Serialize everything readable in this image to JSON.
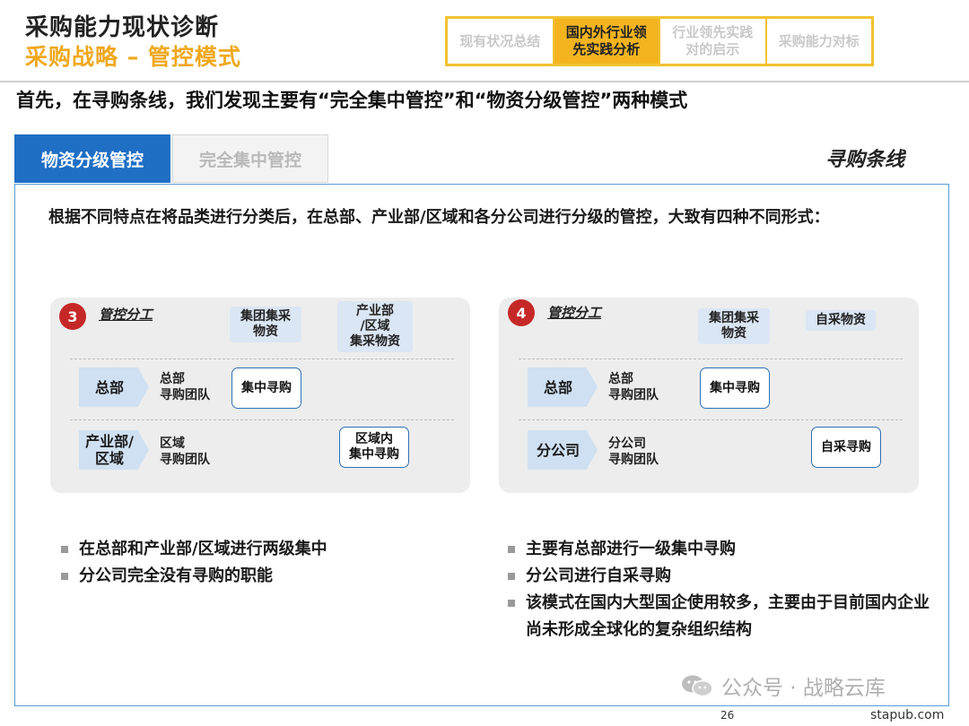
{
  "header": {
    "title": "采购能力现状诊断",
    "subtitle": "采购战略 – 管控模式",
    "nav_tabs": [
      {
        "label": "现有状况总结",
        "active": false
      },
      {
        "label": "国内外行业领\n先实践分析",
        "active": true
      },
      {
        "label": "行业领先实践\n对的启示",
        "active": false
      },
      {
        "label": "采购能力对标",
        "active": false
      }
    ]
  },
  "headline": "首先，在寻购条线，我们发现主要有“完全集中管控”和“物资分级管控”两种模式",
  "tabs": {
    "active": "物资分级管控",
    "inactive": "完全集中管控",
    "right_label": "寻购条线"
  },
  "intro": "根据不同特点在将品类进行分类后，在总部、产业部/区域和各分公司进行分级的管控，大致有四种不同形式：",
  "diagrams": [
    {
      "number": "3",
      "title": "管控分工",
      "col1": "集团集采\n物资",
      "col2": "产业部\n/区域\n集采物资",
      "row1_arrow": "总部",
      "row1_team": "总部\n寻购团队",
      "row1_box": "集中寻购",
      "row2_arrow": "产业部/\n区域",
      "row2_team": "区域\n寻购团队",
      "row2_box": "区域内\n集中寻购"
    },
    {
      "number": "4",
      "title": "管控分工",
      "col1": "集团集采\n物资",
      "col2": "自采物资",
      "row1_arrow": "总部",
      "row1_team": "总部\n寻购团队",
      "row1_box": "集中寻购",
      "row2_arrow": "分公司",
      "row2_team": "分公司\n寻购团队",
      "row2_box": "自采寻购"
    }
  ],
  "bullets_left": [
    "在总部和产业部/区域进行两级集中",
    "分公司完全没有寻购的职能"
  ],
  "bullets_right": [
    "主要有总部进行一级集中寻购",
    "分公司进行自采寻购",
    "该模式在国内大型国企使用较多，主要由于目前国内企业尚未形成全球化的复杂组织结构"
  ],
  "watermark": "公众号 · 战略云库",
  "page_number": "26",
  "site": "stapub.com",
  "colors": {
    "accent_orange": "#f3b420",
    "blue": "#1f6fc5",
    "panel_border": "#5a9bd5",
    "badge_red": "#c62828"
  }
}
